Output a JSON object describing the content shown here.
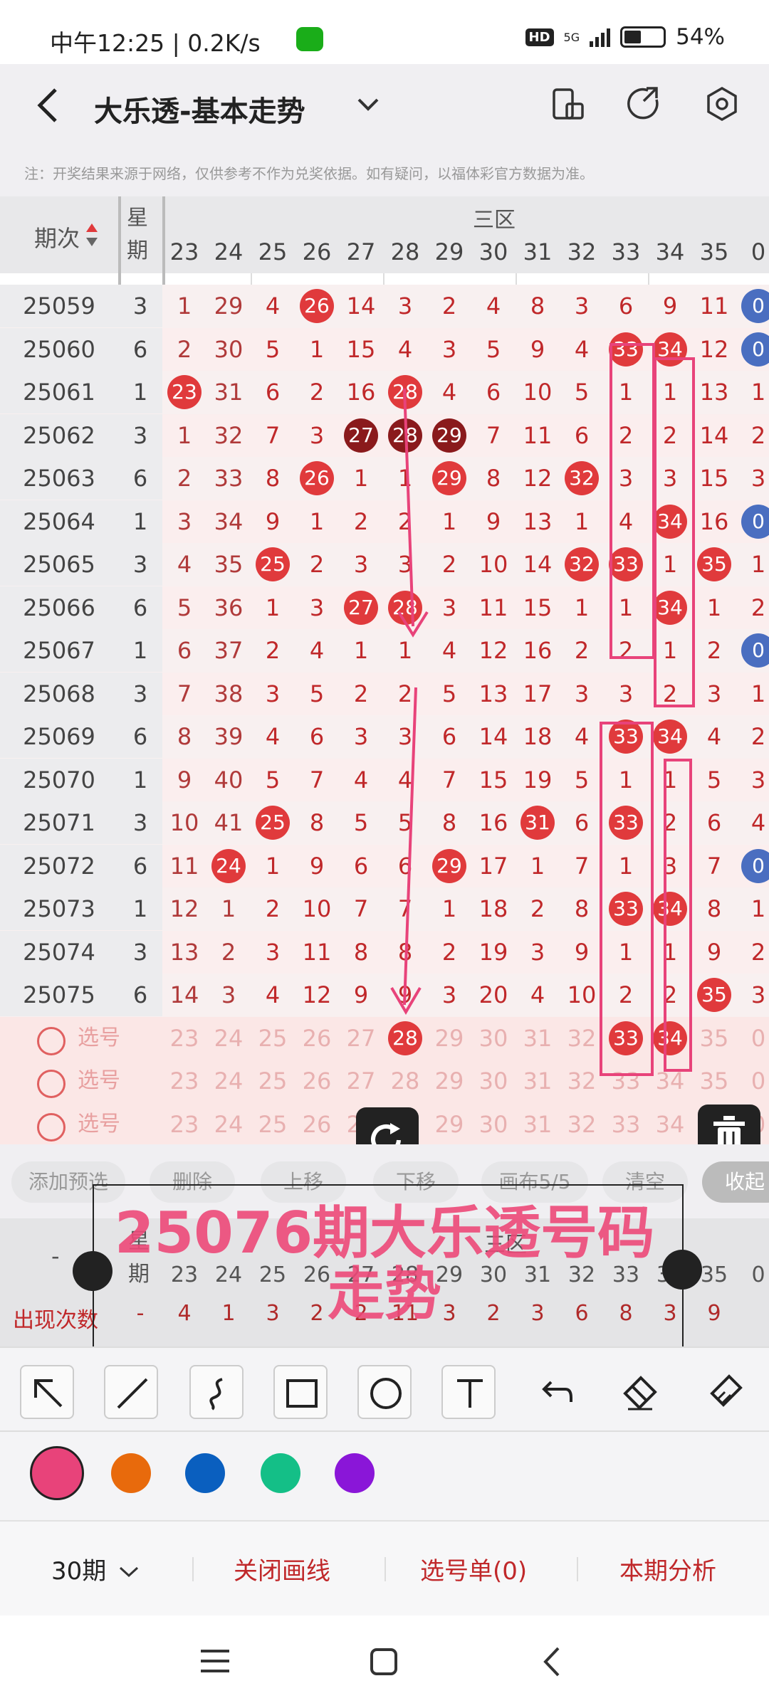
{
  "status": {
    "time": "中午12:25",
    "speed": "0.2K/s",
    "hd": "HD",
    "net": "5G",
    "battery": "54%"
  },
  "app": {
    "title": "大乐透-基本走势"
  },
  "note": "注：开奖结果来源于网络，仅供参考不作为兑奖依据。如有疑问，以福体彩官方数据为准。",
  "table": {
    "col_issue": "期次",
    "col_week": "星期",
    "zone": "三区",
    "nums": [
      "23",
      "24",
      "25",
      "26",
      "27",
      "28",
      "29",
      "30",
      "31",
      "32",
      "33",
      "34",
      "35",
      "0"
    ],
    "rows": [
      {
        "issue": "25059",
        "week": "3",
        "vals": [
          "1",
          "29",
          "4",
          "26",
          "14",
          "3",
          "2",
          "4",
          "8",
          "3",
          "6",
          "9",
          "11",
          "0"
        ],
        "hits": [
          3
        ],
        "blue": [
          13
        ]
      },
      {
        "issue": "25060",
        "week": "6",
        "vals": [
          "2",
          "30",
          "5",
          "1",
          "15",
          "4",
          "3",
          "5",
          "9",
          "4",
          "33",
          "34",
          "12",
          "0"
        ],
        "hits": [
          10,
          11
        ],
        "blue": [
          13
        ]
      },
      {
        "issue": "25061",
        "week": "1",
        "vals": [
          "23",
          "31",
          "6",
          "2",
          "16",
          "28",
          "4",
          "6",
          "10",
          "5",
          "1",
          "1",
          "13",
          "1"
        ],
        "hits": [
          0,
          5
        ],
        "blue": []
      },
      {
        "issue": "25062",
        "week": "3",
        "vals": [
          "1",
          "32",
          "7",
          "3",
          "27",
          "28",
          "29",
          "7",
          "11",
          "6",
          "2",
          "2",
          "14",
          "2"
        ],
        "hits": [],
        "dark": [
          4,
          5,
          6
        ],
        "blue": []
      },
      {
        "issue": "25063",
        "week": "6",
        "vals": [
          "2",
          "33",
          "8",
          "26",
          "1",
          "1",
          "29",
          "8",
          "12",
          "32",
          "3",
          "3",
          "15",
          "3"
        ],
        "hits": [
          3,
          6,
          9
        ],
        "blue": []
      },
      {
        "issue": "25064",
        "week": "1",
        "vals": [
          "3",
          "34",
          "9",
          "1",
          "2",
          "2",
          "1",
          "9",
          "13",
          "1",
          "4",
          "34",
          "16",
          "0"
        ],
        "hits": [
          11
        ],
        "blue": [
          13
        ]
      },
      {
        "issue": "25065",
        "week": "3",
        "vals": [
          "4",
          "35",
          "25",
          "2",
          "3",
          "3",
          "2",
          "10",
          "14",
          "32",
          "33",
          "1",
          "35",
          "1"
        ],
        "hits": [
          2,
          9,
          10,
          12
        ],
        "blue": []
      },
      {
        "issue": "25066",
        "week": "6",
        "vals": [
          "5",
          "36",
          "1",
          "3",
          "27",
          "28",
          "3",
          "11",
          "15",
          "1",
          "1",
          "34",
          "1",
          "2"
        ],
        "hits": [
          4,
          5,
          11
        ],
        "blue": []
      },
      {
        "issue": "25067",
        "week": "1",
        "vals": [
          "6",
          "37",
          "2",
          "4",
          "1",
          "1",
          "4",
          "12",
          "16",
          "2",
          "2",
          "1",
          "2",
          "0"
        ],
        "hits": [],
        "blue": [
          13
        ]
      },
      {
        "issue": "25068",
        "week": "3",
        "vals": [
          "7",
          "38",
          "3",
          "5",
          "2",
          "2",
          "5",
          "13",
          "17",
          "3",
          "3",
          "2",
          "3",
          "1"
        ],
        "hits": [],
        "blue": []
      },
      {
        "issue": "25069",
        "week": "6",
        "vals": [
          "8",
          "39",
          "4",
          "6",
          "3",
          "3",
          "6",
          "14",
          "18",
          "4",
          "33",
          "34",
          "4",
          "2"
        ],
        "hits": [
          10,
          11
        ],
        "blue": []
      },
      {
        "issue": "25070",
        "week": "1",
        "vals": [
          "9",
          "40",
          "5",
          "7",
          "4",
          "4",
          "7",
          "15",
          "19",
          "5",
          "1",
          "1",
          "5",
          "3"
        ],
        "hits": [],
        "blue": []
      },
      {
        "issue": "25071",
        "week": "3",
        "vals": [
          "10",
          "41",
          "25",
          "8",
          "5",
          "5",
          "8",
          "16",
          "31",
          "6",
          "33",
          "2",
          "6",
          "4"
        ],
        "hits": [
          2,
          8,
          10
        ],
        "blue": []
      },
      {
        "issue": "25072",
        "week": "6",
        "vals": [
          "11",
          "24",
          "1",
          "9",
          "6",
          "6",
          "29",
          "17",
          "1",
          "7",
          "1",
          "3",
          "7",
          "0"
        ],
        "hits": [
          1,
          6
        ],
        "blue": [
          13
        ]
      },
      {
        "issue": "25073",
        "week": "1",
        "vals": [
          "12",
          "1",
          "2",
          "10",
          "7",
          "7",
          "1",
          "18",
          "2",
          "8",
          "33",
          "34",
          "8",
          "1"
        ],
        "hits": [
          10,
          11
        ],
        "blue": []
      },
      {
        "issue": "25074",
        "week": "3",
        "vals": [
          "13",
          "2",
          "3",
          "11",
          "8",
          "8",
          "2",
          "19",
          "3",
          "9",
          "1",
          "1",
          "9",
          "2"
        ],
        "hits": [],
        "blue": []
      },
      {
        "issue": "25075",
        "week": "6",
        "vals": [
          "14",
          "3",
          "4",
          "12",
          "9",
          "9",
          "3",
          "20",
          "4",
          "10",
          "2",
          "2",
          "35",
          "3"
        ],
        "hits": [
          12
        ],
        "blue": []
      }
    ],
    "select_label": "选号",
    "select_rows": [
      {
        "vals": [
          "23",
          "24",
          "25",
          "26",
          "27",
          "28",
          "29",
          "30",
          "31",
          "32",
          "33",
          "34",
          "35",
          "0"
        ],
        "hits": [
          5,
          10,
          11
        ]
      },
      {
        "vals": [
          "23",
          "24",
          "25",
          "26",
          "27",
          "28",
          "29",
          "30",
          "31",
          "32",
          "33",
          "34",
          "35",
          "0"
        ],
        "hits": []
      },
      {
        "vals": [
          "23",
          "24",
          "25",
          "26",
          "27",
          "28",
          "29",
          "30",
          "31",
          "32",
          "33",
          "34",
          "35",
          "0"
        ],
        "hits": []
      }
    ]
  },
  "toolbar": [
    "添加预选",
    "删除",
    "上移",
    "下移",
    "画布5/5",
    "清空",
    "收起"
  ],
  "stats": {
    "label": "出现次数",
    "values": [
      "-",
      "4",
      "1",
      "3",
      "2",
      "2",
      "11",
      "3",
      "2",
      "3",
      "6",
      "8",
      "3",
      "9"
    ],
    "zone": "三区",
    "dash": "-"
  },
  "overlay": {
    "line1": "25076期大乐透号码",
    "line2": "走势"
  },
  "colors": [
    "#e8437a",
    "#e86a0c",
    "#0a5fbf",
    "#14bf87",
    "#8a16d8"
  ],
  "bottom": {
    "period": "30期",
    "close_line": "关闭画线",
    "select_list": "选号单(0)",
    "analysis": "本期分析"
  }
}
